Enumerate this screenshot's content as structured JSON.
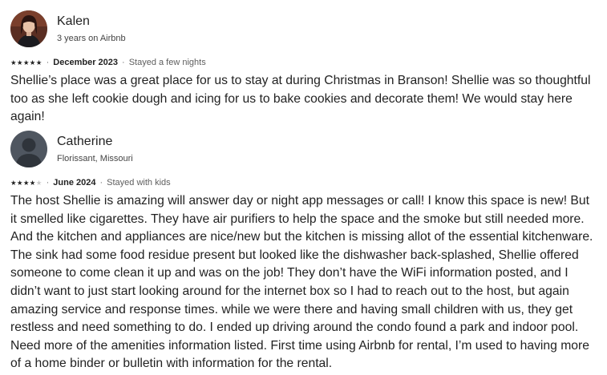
{
  "reviews": [
    {
      "name": "Kalen",
      "subtitle": "3 years on Airbnb",
      "rating": 5,
      "date": "December 2023",
      "stay": "Stayed a few nights",
      "text": "Shellie’s place was a great place for us to stay at during Christmas in Branson! Shellie was so thoughtful too as she left cookie dough and icing for us to bake cookies and decorate them! We would stay here again!",
      "avatar_icon": "avatar-photo-icon"
    },
    {
      "name": "Catherine",
      "subtitle": "Florissant, Missouri",
      "rating": 4,
      "date": "June 2024",
      "stay": "Stayed with kids",
      "text": "The host Shellie is amazing will answer day or night app messages or call! I know this space is new! But it smelled like cigarettes. They have air purifiers to help the space and the smoke but still needed more. And the kitchen and appliances are nice/new but the kitchen is missing allot of the essential kitchenware. The sink had some food residue present but looked like the dishwasher back-splashed,  Shellie offered someone to come clean it up and was on the job! They don’t have the WiFi information posted, and I didn’t want to just start looking around for the internet box so I had to reach out to the host, but again amazing service and response times. while we were there and having small children with us, they get restless and need something to do. I ended up driving around the condo found a park and indoor pool. Need more of the amenities information listed. First time using Airbnb for rental, I’m used to having more of a home binder or bulletin with information for the rental.",
      "avatar_icon": "default-user-icon"
    }
  ],
  "separator": "·",
  "colors": {
    "text": "#222222",
    "muted": "#717171",
    "star_on": "#222222",
    "star_off": "#c8c8c8",
    "default_avatar_bg": "#4f5660"
  }
}
